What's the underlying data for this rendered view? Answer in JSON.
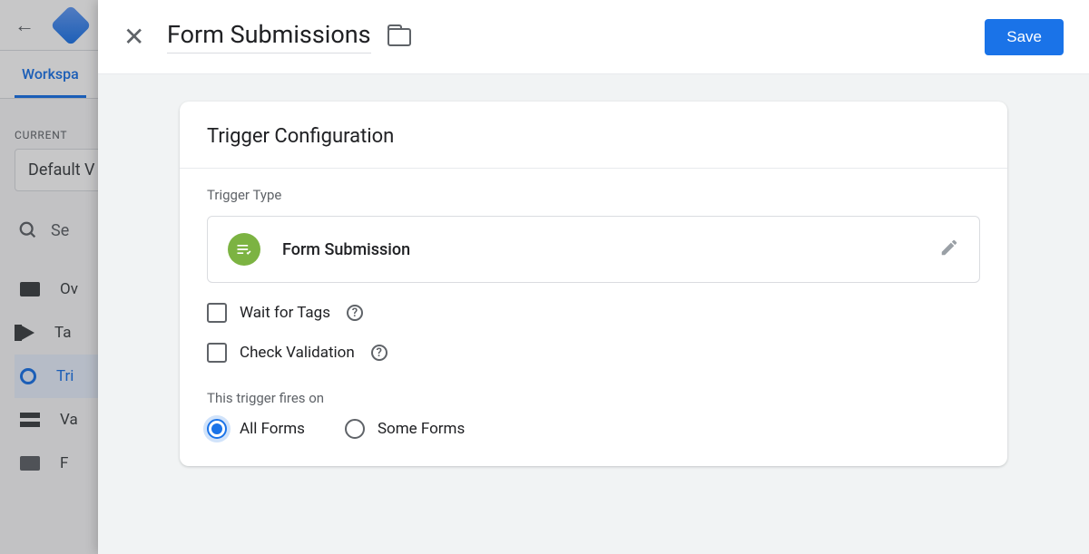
{
  "background": {
    "tab_active": "Workspa",
    "current_label": "CURRENT",
    "workspace_name": "Default V",
    "search_placeholder": "Se",
    "nav": [
      "Ov",
      "Ta",
      "Tri",
      "Va",
      "F"
    ]
  },
  "modal": {
    "title": "Form Submissions",
    "save_label": "Save",
    "card_title": "Trigger Configuration",
    "trigger_type_label": "Trigger Type",
    "trigger_type_value": "Form Submission",
    "check_wait": "Wait for Tags",
    "check_validation": "Check Validation",
    "fires_label": "This trigger fires on",
    "radio_all": "All Forms",
    "radio_some": "Some Forms"
  }
}
